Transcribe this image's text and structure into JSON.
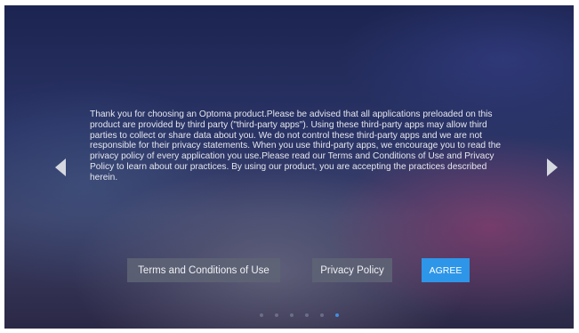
{
  "navigation": {
    "prev_icon": "triangle-left-icon",
    "next_icon": "triangle-right-icon"
  },
  "message": {
    "text": "Thank you for choosing an Optoma product.Please be advised that all applications preloaded on this product are provided by third party (\"third-party apps\"). Using these third-party apps may allow third parties to collect or share data about you. We do not control these third-party apps and we are not responsible for their privacy statements. When you use third-party apps, we encourage you to read the privacy policy of every application you use.Please read our Terms and Conditions of Use and Privacy Policy to learn about our practices. By using our product, you are accepting the practices described herein."
  },
  "buttons": {
    "terms_label": "Terms and Conditions of Use",
    "privacy_label": "Privacy Policy",
    "agree_label": "AGREE"
  },
  "pagination": {
    "total": 6,
    "active_index": 5
  },
  "colors": {
    "accent": "#2e96e8",
    "button_bg": "#5f6476",
    "text": "#e6e7ee"
  }
}
